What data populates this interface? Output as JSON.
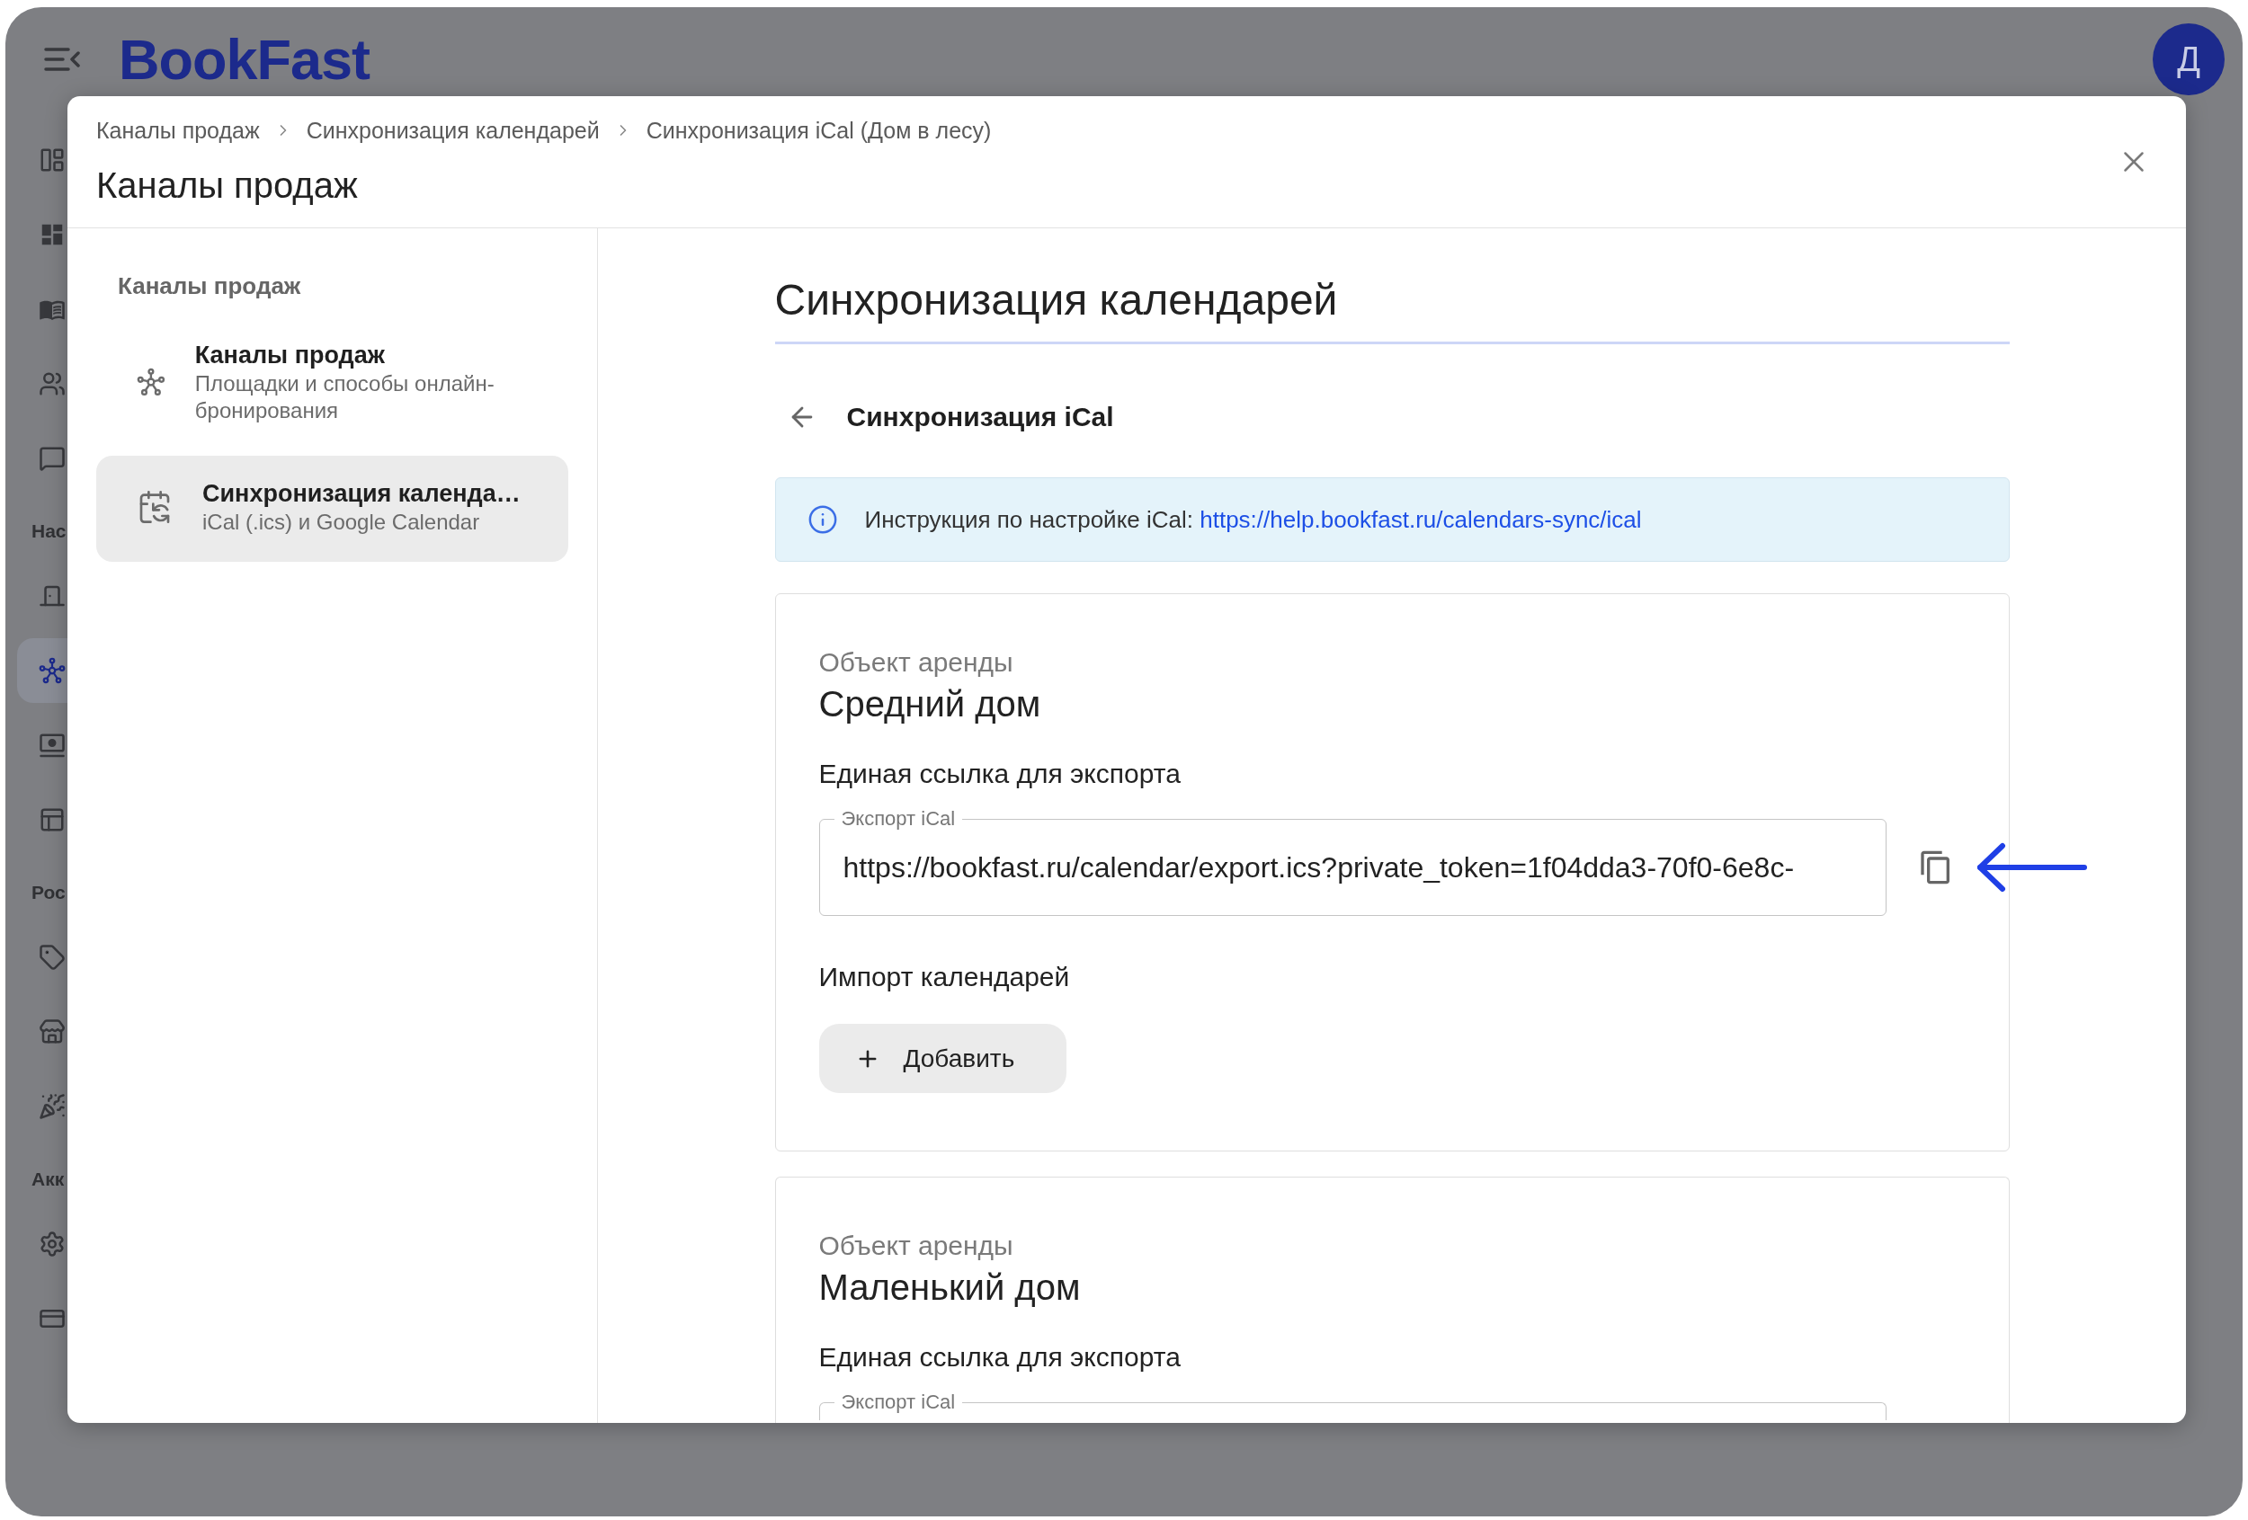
{
  "app_bar": {
    "logo": "BookFast",
    "avatar": "Д"
  },
  "nav_rail": {
    "groups": [
      {
        "items": [
          {
            "selected": false
          },
          {
            "selected": false
          },
          {
            "selected": false
          },
          {
            "selected": false
          },
          {
            "selected": false
          }
        ]
      },
      {
        "label": "Нас",
        "items": [
          {
            "selected": false
          },
          {
            "selected": true
          },
          {
            "selected": false
          },
          {
            "selected": false
          }
        ]
      },
      {
        "label": "Рос",
        "items": [
          {
            "selected": false
          },
          {
            "selected": false
          },
          {
            "selected": false
          }
        ]
      },
      {
        "label": "Акк",
        "items": [
          {
            "selected": false
          },
          {
            "selected": false
          }
        ]
      }
    ]
  },
  "dialog": {
    "breadcrumbs": [
      "Каналы продаж",
      "Синхронизация календарей",
      "Синхронизация iCal (Дом в лесу)"
    ],
    "title": "Каналы продаж",
    "sidebar": {
      "heading": "Каналы продаж",
      "items": [
        {
          "kind": "channels",
          "title": "Каналы продаж",
          "subtitle": "Площадки и способы онлайн-бронирования",
          "selected": false
        },
        {
          "kind": "calendar_sync",
          "title": "Синхронизация календа…",
          "subtitle": "iCal (.ics) и Google Calendar",
          "selected": true
        }
      ]
    },
    "content": {
      "title": "Синхронизация календарей",
      "subheading": "Синхронизация iCal",
      "info": {
        "text": "Инструкция по настройке iCal:",
        "link": "https://help.bookfast.ru/calendars-sync/ical"
      },
      "properties": [
        {
          "caption": "Объект аренды",
          "name": "Средний дом",
          "export_heading": "Единая ссылка для экспорта",
          "export_field": {
            "label": "Экспорт iCal",
            "value": "https://bookfast.ru/calendar/export.ics?private_token=1f04dda3-70f0-6e8c-",
            "arrow": true
          },
          "import_heading": "Импорт календарей",
          "add_button": "Добавить"
        },
        {
          "caption": "Объект аренды",
          "name": "Маленький дом",
          "export_heading": "Единая ссылка для экспорта",
          "export_field": {
            "label": "Экспорт iCal"
          }
        }
      ]
    }
  }
}
